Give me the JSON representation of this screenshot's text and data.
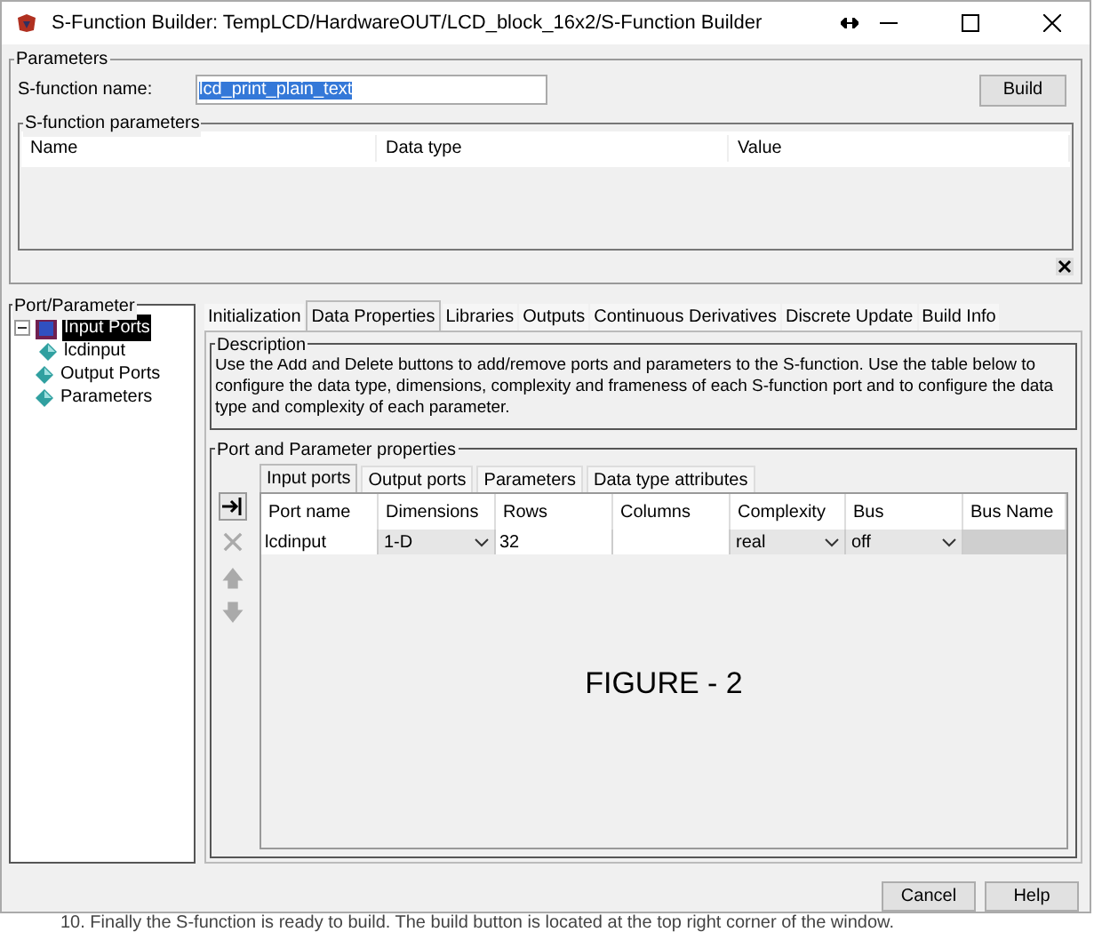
{
  "window": {
    "title": "S-Function Builder: TempLCD/HardwareOUT/LCD_block_16x2/S-Function Builder"
  },
  "parameters": {
    "title": "Parameters",
    "name_label": "S-function name:",
    "name_value": "lcd_print_plain_text",
    "build_button": "Build",
    "sfunction_parameters": {
      "title": "S-function parameters",
      "columns": [
        "Name",
        "Data type",
        "Value"
      ]
    }
  },
  "port_parameter": {
    "title": "Port/Parameter",
    "tree": [
      {
        "label": "Input Ports",
        "selected": true,
        "expanded": true,
        "children": [
          {
            "label": "lcdinput",
            "selected": false
          }
        ]
      },
      {
        "label": "Output Ports",
        "selected": false
      },
      {
        "label": "Parameters",
        "selected": false
      }
    ]
  },
  "tabs": [
    {
      "label": "Initialization",
      "selected": false
    },
    {
      "label": "Data Properties",
      "selected": true
    },
    {
      "label": "Libraries",
      "selected": false
    },
    {
      "label": "Outputs",
      "selected": false
    },
    {
      "label": "Continuous Derivatives",
      "selected": false
    },
    {
      "label": "Discrete Update",
      "selected": false
    },
    {
      "label": "Build Info",
      "selected": false
    }
  ],
  "description": {
    "title": "Description",
    "text": "Use the Add and Delete buttons to add/remove ports and parameters to the S-function. Use the table below to configure the data type, dimensions, complexity and frameness of each S-function port and to configure the data type and complexity of each parameter."
  },
  "properties": {
    "title": "Port and Parameter properties",
    "subtabs": [
      {
        "label": "Input ports",
        "selected": true
      },
      {
        "label": "Output ports",
        "selected": false
      },
      {
        "label": "Parameters",
        "selected": false
      },
      {
        "label": "Data type attributes",
        "selected": false
      }
    ],
    "tools": [
      {
        "kind": "add",
        "disabled": false
      },
      {
        "kind": "delete",
        "disabled": true
      },
      {
        "kind": "up",
        "disabled": true
      },
      {
        "kind": "down",
        "disabled": true
      }
    ],
    "columns": [
      "Port name",
      "Dimensions",
      "Rows",
      "Columns",
      "Complexity",
      "Bus",
      "Bus Name"
    ],
    "rows": [
      [
        {
          "kind": "text",
          "value": "lcdinput"
        },
        {
          "kind": "dropdown",
          "value": "1-D"
        },
        {
          "kind": "text",
          "value": "32"
        },
        {
          "kind": "text"
        },
        {
          "kind": "dropdown",
          "value": "real"
        },
        {
          "kind": "dropdown",
          "value": "off"
        },
        {
          "kind": "disabled"
        }
      ]
    ],
    "overlay": "FIGURE - 2"
  },
  "buttons": [
    "Cancel",
    "Help"
  ],
  "caption": "10. Finally the S-function is ready to build. The build button is located at the top right corner of the window."
}
